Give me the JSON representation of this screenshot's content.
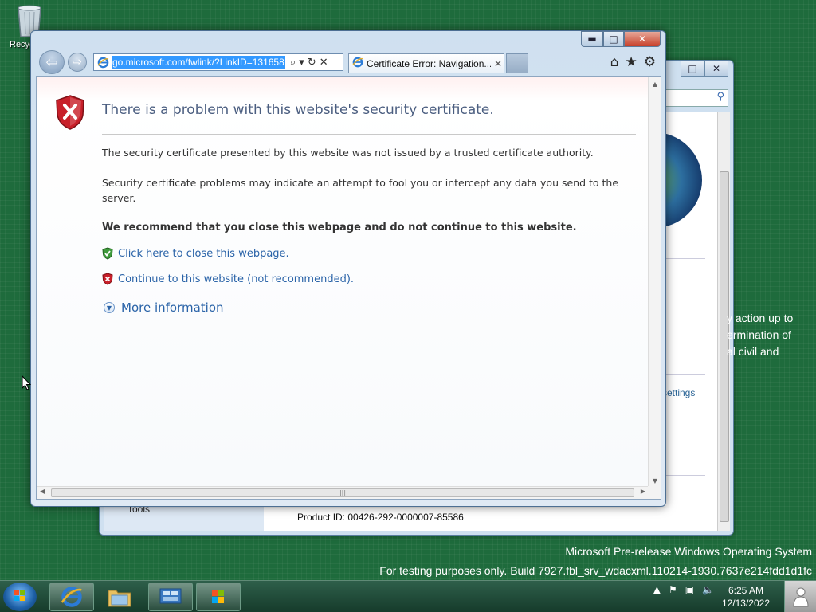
{
  "desktop": {
    "recycle_label": "Recyc",
    "bg_text_lines": [
      "y action up to",
      "ermination of",
      "al civil and"
    ],
    "watermark_line1": "Microsoft Pre-release Windows Operating System",
    "watermark_line2": "For testing purposes only. Build 7927.fbl_srv_wdacxml.110214-1930.7637e214fdd1d1fc"
  },
  "background_window": {
    "settings_link": "settings",
    "tools_label": "Tools",
    "product_id": "Product ID: 00426-292-0000007-85586",
    "controls": [
      "□",
      "✕"
    ]
  },
  "browser": {
    "window_controls": {
      "minimize": "▬",
      "maximize": "□",
      "close": "✕"
    },
    "address_url": "go.microsoft.com/fwlink/?LinkID=131658",
    "address_tools": [
      "⌕",
      "▾",
      "↻",
      "✕"
    ],
    "tab_title": "Certificate Error: Navigation...",
    "tab_close": "✕",
    "command_icons": [
      "⌂",
      "★",
      "⚙"
    ],
    "back_glyph": "⇦",
    "forward_glyph": "⇨"
  },
  "cert_page": {
    "title": "There is a problem with this website's security certificate.",
    "para1": "The security certificate presented by this website was not issued by a trusted certificate authority.",
    "para2": "Security certificate problems may indicate an attempt to fool you or intercept any data you send to the server.",
    "recommendation": "We recommend that you close this webpage and do not continue to this website.",
    "close_link": "Click here to close this webpage.",
    "continue_link": "Continue to this website (not recommended).",
    "more_info": "More information"
  },
  "taskbar": {
    "time": "6:25 AM",
    "date": "12/13/2022"
  },
  "colors": {
    "desktop_green": "#1e6b3c",
    "link_blue": "#2a63a8",
    "title_blue": "#4b5e80",
    "shield_red": "#c8202a",
    "shield_green": "#3f9a3b"
  }
}
